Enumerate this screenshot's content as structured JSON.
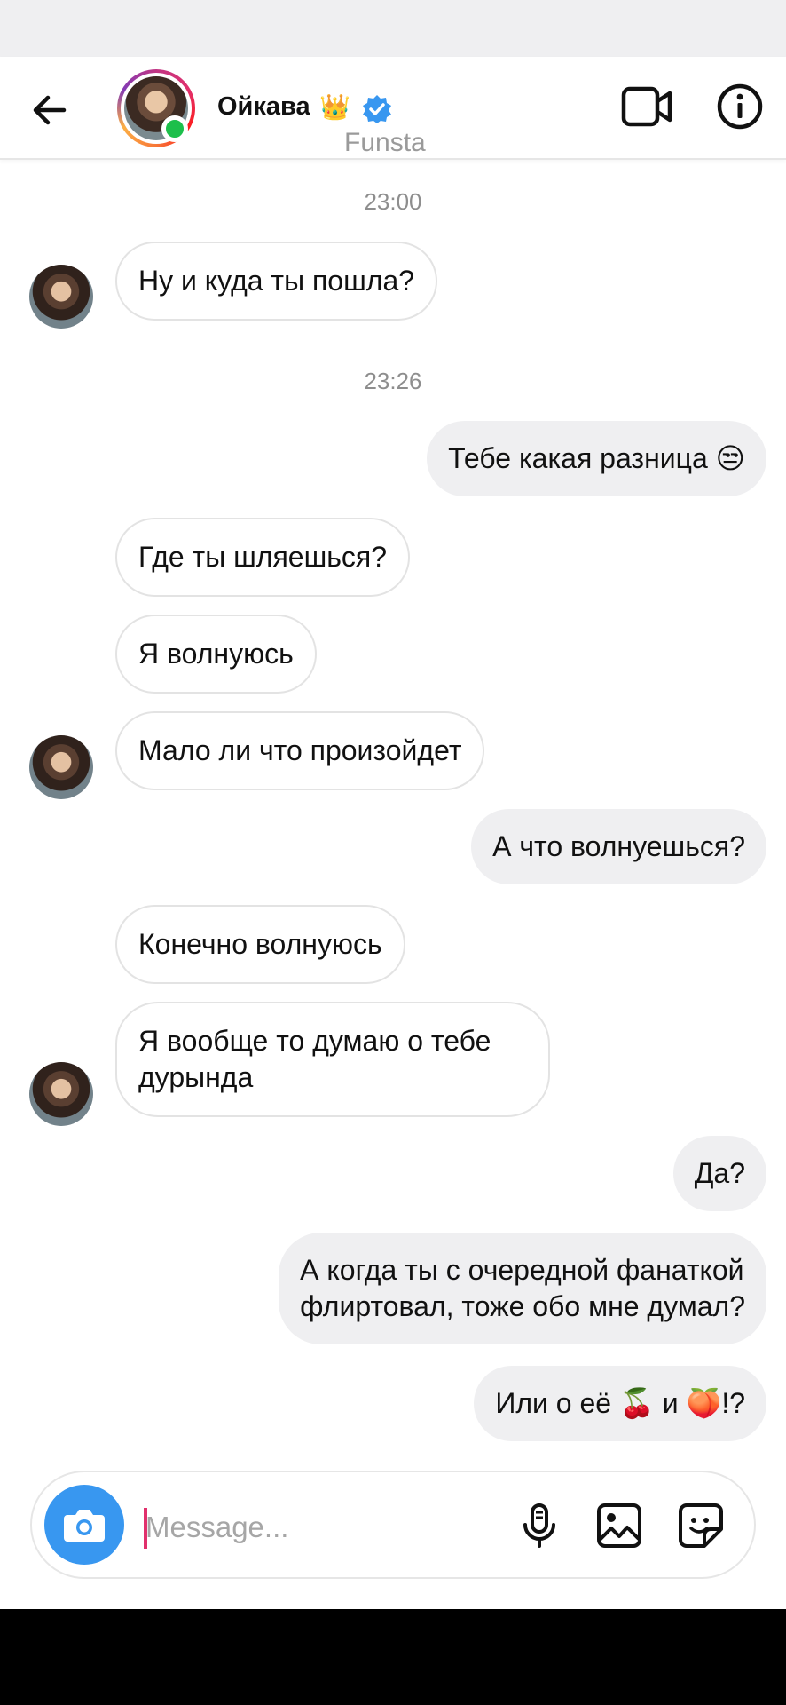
{
  "header": {
    "contact_name": "Ойкава",
    "subtitle": "Funsta",
    "crown_emoji": "👑",
    "icons": [
      "back-arrow-icon",
      "video-call-icon",
      "info-icon",
      "verified-icon"
    ]
  },
  "messages": {
    "time_1": "23:00",
    "time_2": "23:26",
    "m1": "Ну и куда ты пошла?",
    "m2_text": "Тебе какая разница ",
    "m2_emoji": "😒",
    "m3": "Где ты шляешься?",
    "m4": "Я волнуюсь",
    "m5": "Мало ли что произойдет",
    "m6": "А что волнуешься?",
    "m7": "Конечно волнуюсь",
    "m8_line1": "Я вообще то думаю о тебе",
    "m8_line2": "дурында",
    "m9": "Да?",
    "m10_line1": "А когда ты с очередной фанаткой",
    "m10_line2": "флиртовал, тоже обо мне думал?",
    "m11_a": "Или о её ",
    "m11_emoji1": "🍒",
    "m11_b": " и ",
    "m11_emoji2": "🍑",
    "m11_c": "!?"
  },
  "composer": {
    "placeholder": "Message...",
    "icons": [
      "camera-icon",
      "microphone-icon",
      "gallery-icon",
      "sticker-icon"
    ]
  },
  "colors": {
    "accent": "#3897f0",
    "online": "#1dbf4b",
    "outgoing_bubble": "#efeff1",
    "incoming_border": "#e3e3e3"
  }
}
